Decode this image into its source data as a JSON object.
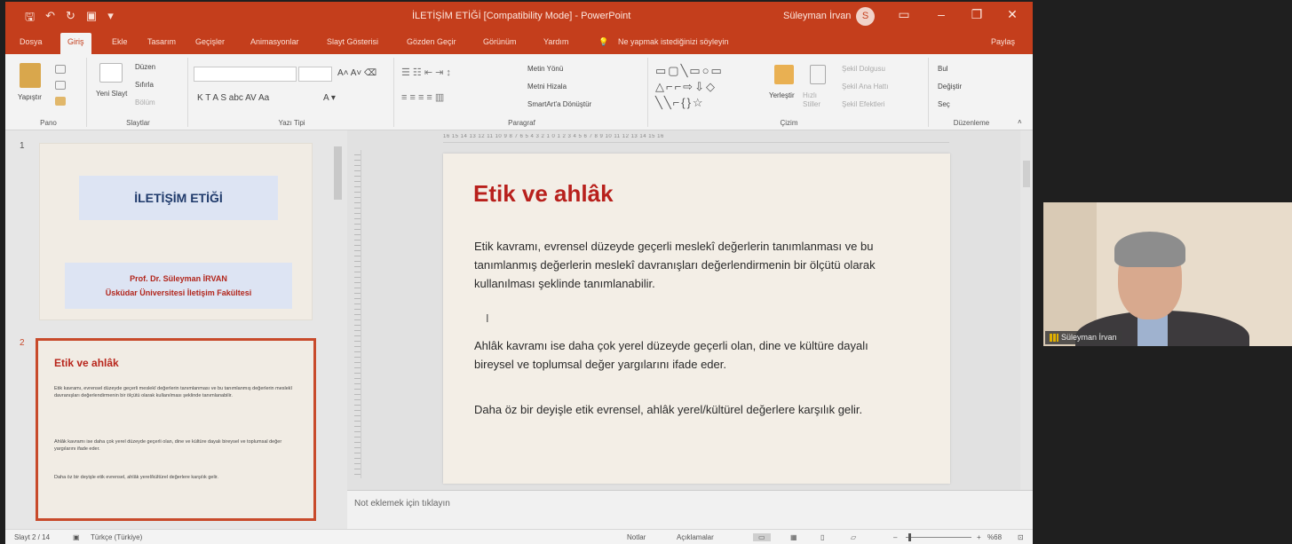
{
  "titlebar": {
    "document_title": "İLETİŞİM ETİĞİ [Compatibility Mode] - PowerPoint",
    "user_name": "Süleyman İrvan",
    "avatar_initial": "S"
  },
  "tabs": [
    {
      "label": "Dosya",
      "active": false
    },
    {
      "label": "Giriş",
      "active": true
    },
    {
      "label": "Ekle",
      "active": false
    },
    {
      "label": "Tasarım",
      "active": false
    },
    {
      "label": "Geçişler",
      "active": false
    },
    {
      "label": "Animasyonlar",
      "active": false
    },
    {
      "label": "Slayt Gösterisi",
      "active": false
    },
    {
      "label": "Gözden Geçir",
      "active": false
    },
    {
      "label": "Görünüm",
      "active": false
    },
    {
      "label": "Yardım",
      "active": false
    },
    {
      "label": "Ne yapmak istediğinizi söyleyin",
      "active": false
    }
  ],
  "share_label": "Paylaş",
  "ribbon": {
    "paste": "Yapıştır",
    "new_slide": "Yeni Slayt",
    "layout": "Düzen",
    "reset": "Sıfırla",
    "section": "Bölüm",
    "text_direction": "Metin Yönü",
    "align_text": "Metni Hizala",
    "smartart": "SmartArt'a Dönüştür",
    "arrange": "Yerleştir",
    "quick_styles": "Hızlı Stiller",
    "shape_fill": "Şekil Dolgusu",
    "shape_outline": "Şekil Ana Hattı",
    "shape_effects": "Şekil Efektleri",
    "find": "Bul",
    "replace": "Değiştir",
    "select": "Seç",
    "format_buttons": "K  T  A  S  abc  AV  Aa",
    "group_labels": {
      "clipboard": "Pano",
      "slides": "Slaytlar",
      "font": "Yazı Tipi",
      "paragraph": "Paragraf",
      "drawing": "Çizim",
      "editing": "Düzenleme"
    }
  },
  "thumbnails": [
    {
      "number": "1",
      "title": "İLETİŞİM ETİĞİ",
      "author_line1": "Prof. Dr. Süleyman İRVAN",
      "author_line2": "Üsküdar Üniversitesi İletişim Fakültesi"
    },
    {
      "number": "2",
      "title": "Etik ve ahlâk",
      "para1": "Etik kavramı, evrensel düzeyde geçerli meslekî değerlerin tanımlanması ve bu tanımlanmış değerlerin meslekî davranışları değerlendirmenin bir ölçütü olarak kullanılması şeklinde tanımlanabilir.",
      "para2": "Ahlâk kavramı ise daha çok yerel düzeyde geçerli olan, dine ve kültüre dayalı bireysel ve toplumsal değer yargılarını ifade eder.",
      "para3": "Daha öz bir deyişle etik evrensel, ahlâk yerel/kültürel değerlere karşılık gelir."
    }
  ],
  "slide": {
    "title": "Etik ve ahlâk",
    "para1": "Etik kavramı, evrensel düzeyde geçerli meslekî değerlerin tanımlanması ve bu tanımlanmış değerlerin meslekî davranışları değerlendirmenin bir ölçütü olarak kullanılması şeklinde tanımlanabilir.",
    "cursor_glyph": "I",
    "para2": "Ahlâk kavramı ise daha çok yerel düzeyde geçerli olan, dine ve kültüre dayalı bireysel ve toplumsal değer yargılarını ifade eder.",
    "para3": "Daha öz bir deyişle etik evrensel, ahlâk yerel/kültürel değerlere karşılık gelir."
  },
  "ruler_text": "16 15 14 13 12 11 10 9 8 7 6 5 4 3 2 1 0 1 2 3 4 5 6 7 8 9 10 11 12 13 14 15 16",
  "notes_placeholder": "Not eklemek için tıklayın",
  "statusbar": {
    "slide_counter": "Slayt 2 / 14",
    "language": "Türkçe (Türkiye)",
    "notes": "Notlar",
    "comments": "Açıklamalar",
    "zoom": "%68"
  },
  "webcam": {
    "participant_name": "Süleyman İrvan"
  }
}
